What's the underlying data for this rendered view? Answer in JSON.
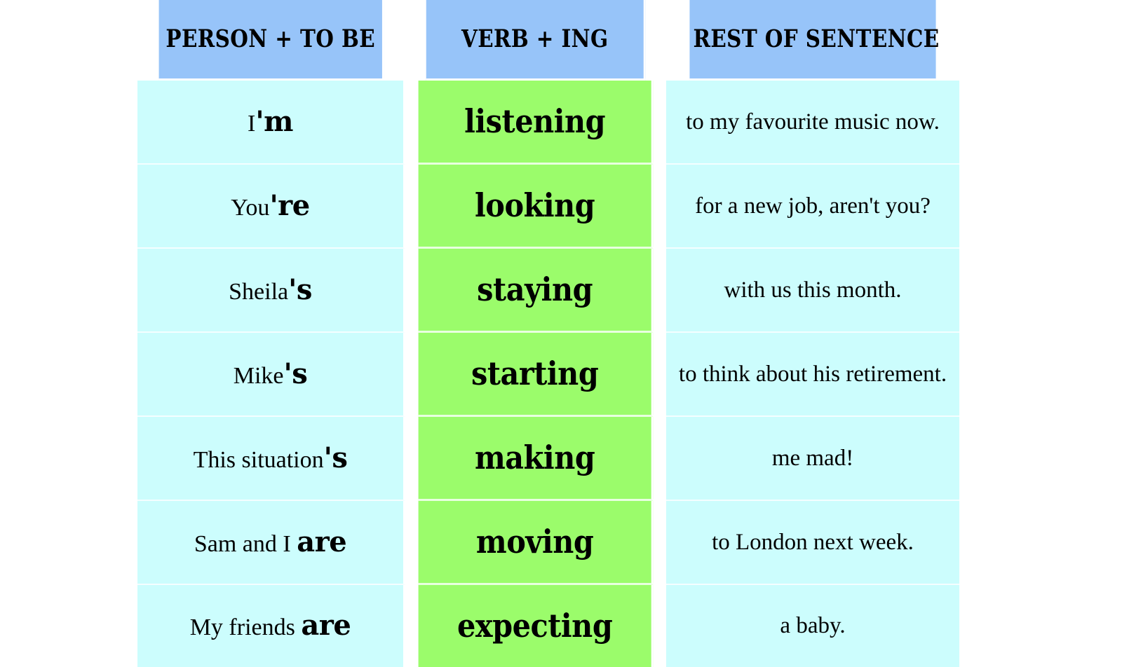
{
  "table": {
    "headers": [
      {
        "label": "PERSON + TO BE"
      },
      {
        "label": "VERB + ING"
      },
      {
        "label": "REST OF SENTENCE"
      }
    ],
    "rows": [
      {
        "subject_base": "I",
        "subject_aux": "'m",
        "verb": "listening",
        "rest": "to my favourite music now."
      },
      {
        "subject_base": "You",
        "subject_aux": "'re",
        "verb": "looking",
        "rest": "for a new job, aren't you?"
      },
      {
        "subject_base": "Sheila",
        "subject_aux": "'s",
        "verb": "staying",
        "rest": "with us this month."
      },
      {
        "subject_base": "Mike",
        "subject_aux": "'s",
        "verb": "starting",
        "rest": "to think about his retirement."
      },
      {
        "subject_base": "This situation",
        "subject_aux": "'s",
        "verb": "making",
        "rest": "me mad!"
      },
      {
        "subject_base": "Sam and I ",
        "subject_aux": "are",
        "verb": "moving",
        "rest": "to London next week."
      },
      {
        "subject_base": "My friends ",
        "subject_aux": "are",
        "verb": "expecting",
        "rest": "a baby."
      }
    ]
  },
  "colors": {
    "header_blue": "#97c4f9",
    "cell_cyan": "#ccfdfd",
    "cell_green": "#9bfc6b",
    "grid_white": "#ffffff",
    "text_black": "#000000",
    "page_background": "#ffffff"
  }
}
